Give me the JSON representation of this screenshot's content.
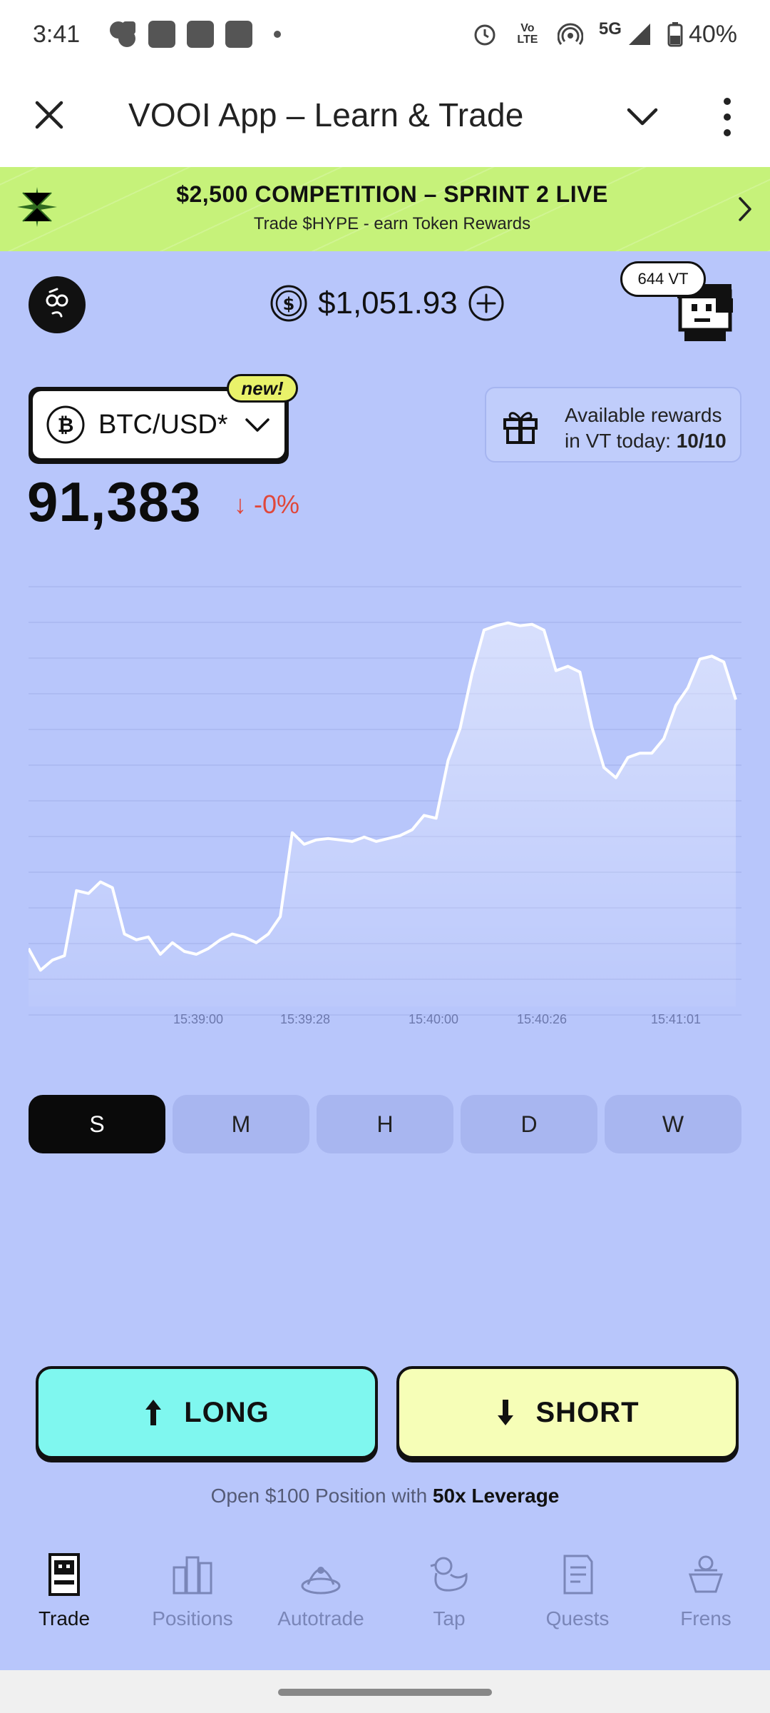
{
  "status_bar": {
    "time": "3:41",
    "network": "5G",
    "battery": "40%",
    "volte_label": "Vo LTE"
  },
  "app_bar": {
    "title": "VOOI App – Learn & Trade"
  },
  "banner": {
    "title": "$2,500 COMPETITION – SPRINT 2 LIVE",
    "subtitle": "Trade $HYPE - earn Token Rewards"
  },
  "account": {
    "balance": "$1,051.93",
    "vt_badge": "644 VT"
  },
  "pair": {
    "label": "BTC/USD*",
    "new_badge": "new!"
  },
  "rewards": {
    "line1": "Available rewards",
    "line2_prefix": "in VT today:",
    "line2_value": "10/10"
  },
  "ticker": {
    "price": "91,383",
    "change": "-0%"
  },
  "chart_data": {
    "type": "area",
    "x_tick_labels": [
      "15:39:00",
      "15:39:28",
      "15:40:00",
      "15:40:26",
      "15:41:01"
    ],
    "values": [
      91280,
      91265,
      91272,
      91275,
      91320,
      91318,
      91326,
      91322,
      91290,
      91286,
      91288,
      91276,
      91284,
      91278,
      91276,
      91280,
      91286,
      91290,
      91288,
      91284,
      91290,
      91302,
      91360,
      91352,
      91355,
      91356,
      91355,
      91354,
      91357,
      91354,
      91356,
      91358,
      91362,
      91372,
      91370,
      91410,
      91432,
      91470,
      91500,
      91503,
      91505,
      91503,
      91504,
      91500,
      91472,
      91475,
      91471,
      91433,
      91405,
      91398,
      91412,
      91415,
      91415,
      91425,
      91448,
      91460,
      91480,
      91482,
      91478,
      91452
    ]
  },
  "time_tabs": [
    "S",
    "M",
    "H",
    "D",
    "W"
  ],
  "actions": {
    "long": "LONG",
    "short": "SHORT"
  },
  "leverage": {
    "prefix": "Open $100 Position with",
    "bold": "50x Leverage"
  },
  "nav": [
    {
      "label": "Trade",
      "icon": "arcade-icon"
    },
    {
      "label": "Positions",
      "icon": "positions-icon"
    },
    {
      "label": "Autotrade",
      "icon": "autotrade-icon"
    },
    {
      "label": "Tap",
      "icon": "duck-icon"
    },
    {
      "label": "Quests",
      "icon": "quests-icon"
    },
    {
      "label": "Frens",
      "icon": "frens-icon"
    }
  ],
  "colors": {
    "background": "#b8c6fb",
    "banner": "#c6f27a",
    "long": "#7ff7ef",
    "short": "#f6feb7",
    "negative": "#e0473a"
  }
}
